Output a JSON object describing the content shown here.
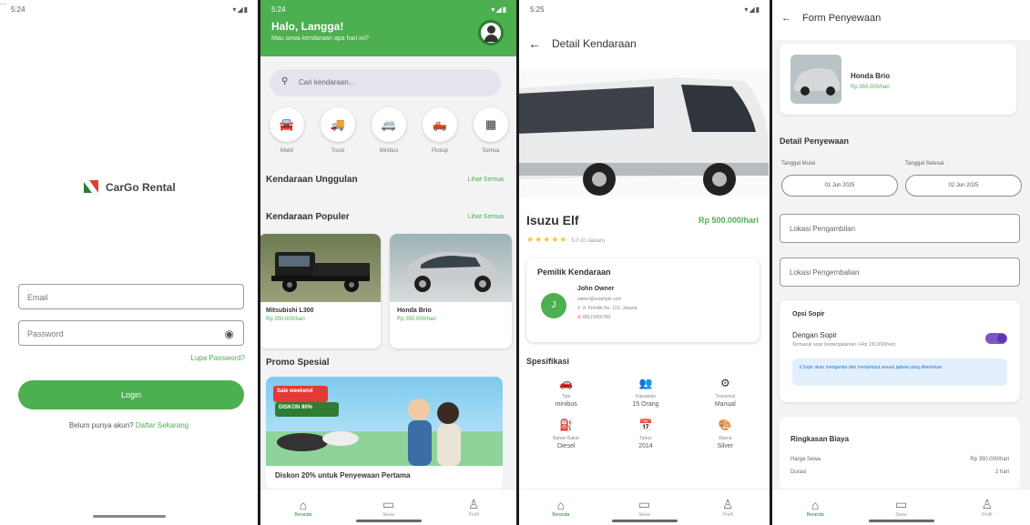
{
  "colors": {
    "primary": "#4caf50",
    "dark_green": "#2e7d32",
    "accent_purple": "#7e57c2",
    "star": "#fbc02d"
  },
  "login": {
    "cut_text": "...",
    "status_time": "5:24",
    "app_name": "CarGo Rental",
    "email_placeholder": "Email",
    "password_placeholder": "Password",
    "forgot": "Lupa Password?",
    "login_button": "Login",
    "signup_prefix": "Belum punya akun?",
    "signup_link": "Daftar Sekarang"
  },
  "home": {
    "status_time": "5:24",
    "greeting": "Halo, Langga!",
    "greeting_sub": "Mau sewa kendaraan apa hari ini?",
    "search_placeholder": "Cari kendaraan...",
    "categories": [
      {
        "label": "Mobil",
        "icon": "car-icon",
        "glyph": "🚘"
      },
      {
        "label": "Truck",
        "icon": "truck-icon",
        "glyph": "🚚"
      },
      {
        "label": "Minibus",
        "icon": "minibus-icon",
        "glyph": "🚐"
      },
      {
        "label": "Pickup",
        "icon": "pickup-icon",
        "glyph": "🛻"
      },
      {
        "label": "Semua",
        "icon": "grid-icon",
        "glyph": "▦"
      }
    ],
    "featured_title": "Kendaraan Unggulan",
    "featured_link": "Lihat Semua",
    "popular_title": "Kendaraan Populer",
    "popular_link": "Lihat Semua",
    "popular": [
      {
        "name": "Mitsubishi L300",
        "price": "Rp 250.000/hari"
      },
      {
        "name": "Honda Brio",
        "price": "Rp 350.000/hari"
      }
    ],
    "promo_title": "Promo Spesial",
    "promo_card_title": "Diskon 20% untuk Penyewaan Pertama",
    "promo_badge": "Sale weekend",
    "promo_discount": "DISKON 80%",
    "nav": [
      {
        "label": "Beranda",
        "icon": "home-icon",
        "glyph": "⌂"
      },
      {
        "label": "Sewa",
        "icon": "rental-icon",
        "glyph": "▭"
      },
      {
        "label": "Profil",
        "icon": "profile-icon",
        "glyph": "♙"
      }
    ]
  },
  "detail": {
    "status_time": "5:25",
    "title": "Detail Kendaraan",
    "vehicle_name": "Isuzu Elf",
    "rate": "Rp 500.000/hari",
    "rating_stars": "★★★★★",
    "rating_text": "5.0 (0 ulasan)",
    "owner_title": "Pemilik Kendaraan",
    "owner_initial": "J",
    "owner_name": "John Owner",
    "owner_email": "owner@example.com",
    "owner_address": "Jl. Pemilik No. 123, Jakarta",
    "owner_phone": "08123456789",
    "spec_title": "Spesifikasi",
    "specs": [
      {
        "label": "Tipe",
        "value": "minibus",
        "icon": "car-type-icon",
        "glyph": "🚗"
      },
      {
        "label": "Kapasitas",
        "value": "15 Orang",
        "icon": "people-icon",
        "glyph": "👥"
      },
      {
        "label": "Transmisi",
        "value": "Manual",
        "icon": "gear-icon",
        "glyph": "⚙"
      },
      {
        "label": "Bahan Bakar",
        "value": "Diesel",
        "icon": "fuel-icon",
        "glyph": "⛽"
      },
      {
        "label": "Tahun",
        "value": "2014",
        "icon": "calendar-icon",
        "glyph": "📅"
      },
      {
        "label": "Warna",
        "value": "Silver",
        "icon": "palette-icon",
        "glyph": "🎨"
      }
    ]
  },
  "form": {
    "title": "Form Penyewaan",
    "car_name": "Honda Brio",
    "car_price": "Rp 350.000/hari",
    "detail_title": "Detail Penyewaan",
    "start_label": "Tanggal Mulai",
    "end_label": "Tanggal Selesai",
    "start_date": "01 Jun 2025",
    "end_date": "02 Jun 2025",
    "pickup_placeholder": "Lokasi Pengambilan",
    "return_placeholder": "Lokasi Pengembalian",
    "driver_title": "Opsi Sopir",
    "driver_option": "Dengan Sopir",
    "driver_sub": "Termasuk sopir berpengalaman (+Rp 150.000/hari)",
    "driver_note": "Sopir akan mengantar dan menjemput sesuai jadwal yang ditentukan",
    "summary_title": "Ringkasan Biaya",
    "summary_rows": [
      {
        "label": "Harga Sewa",
        "value": "Rp 350.000/hari"
      },
      {
        "label": "Durasi",
        "value": "2 hari"
      }
    ]
  }
}
